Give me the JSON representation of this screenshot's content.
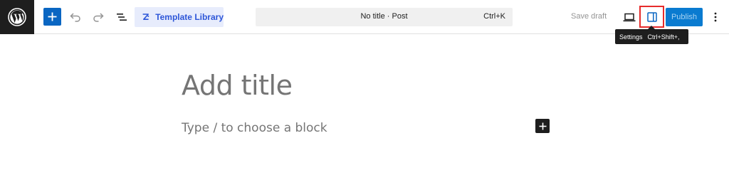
{
  "toolbar": {
    "logo_icon": "wordpress-logo",
    "add_block_icon": "plus-icon",
    "undo_icon": "undo-icon",
    "redo_icon": "redo-icon",
    "document_overview_icon": "list-view-icon",
    "template_library_label": "Template Library",
    "template_library_icon": "template-library-icon",
    "command_bar": {
      "title": "No title · Post",
      "shortcut": "Ctrl+K"
    },
    "save_draft_label": "Save draft",
    "preview_icon": "laptop-icon",
    "settings_icon": "sidebar-icon",
    "publish_label": "Publish",
    "more_icon": "vertical-dots-icon"
  },
  "tooltip": {
    "label": "Settings",
    "shortcut": "Ctrl+Shift+,"
  },
  "editor": {
    "title_placeholder": "Add title",
    "block_placeholder": "Type / to choose a block",
    "inserter_icon": "plus-icon"
  },
  "colors": {
    "primary": "#0a66c2",
    "publish": "#0a7bd0",
    "highlight_outline": "#e62b2b",
    "template_library_bg": "#e7ecfc",
    "template_library_text": "#2d56d8"
  }
}
